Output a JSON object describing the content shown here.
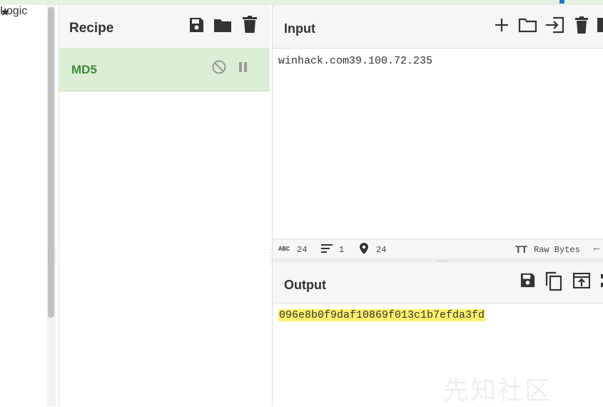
{
  "sidebar": {
    "favourite_icon": "star-icon",
    "partial_label": "Logic"
  },
  "recipe": {
    "title": "Recipe",
    "icons": [
      "save-icon",
      "folder-icon",
      "trash-icon"
    ],
    "operations": [
      {
        "name": "MD5",
        "icons": [
          "disable-icon",
          "pause-icon"
        ]
      }
    ]
  },
  "input": {
    "title": "Input",
    "icons": [
      "add-icon",
      "folder-icon",
      "input-file-icon",
      "trash-icon",
      "layout-icon"
    ],
    "value": "winhack.com39.100.72.235",
    "status": {
      "length": "24",
      "lines": "1",
      "position": "24",
      "encoding": "Raw Bytes"
    }
  },
  "output": {
    "title": "Output",
    "icons": [
      "save-icon",
      "copy-icon",
      "replace-input-icon",
      "expand-icon"
    ],
    "value": "096e8b0f9daf10869f013c1b7efda3fd"
  },
  "watermark": "先知社区",
  "colors": {
    "accent_blue": "#1f78c7",
    "operation_bg": "#dcefd6",
    "operation_text": "#3d8a3b",
    "highlight": "#fff06b"
  }
}
